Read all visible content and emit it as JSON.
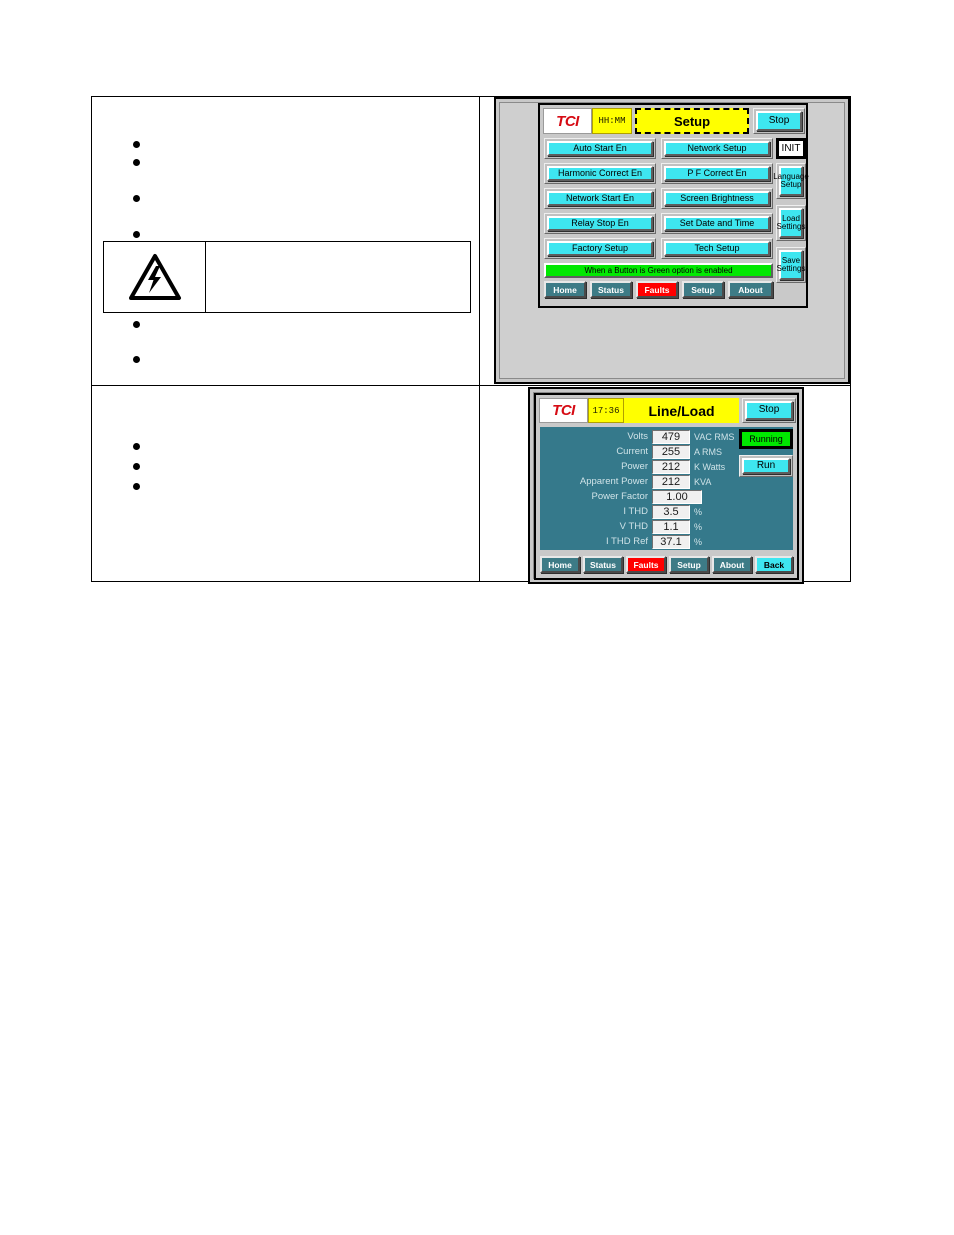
{
  "document": {
    "left_cells": {
      "top_bullets": 6,
      "bottom_bullets": 3
    },
    "warning_box": {
      "icon": "electrical-hazard-triangle-icon",
      "text": ""
    }
  },
  "setup_screen": {
    "logo": "TCI",
    "clock": "HH:MM",
    "title": "Setup",
    "stop_label": "Stop",
    "init_label": "INIT",
    "grid_buttons": [
      {
        "label": "Auto Start En"
      },
      {
        "label": "Network Setup"
      },
      {
        "label": "Harmonic Correct En"
      },
      {
        "label": "P F Correct En"
      },
      {
        "label": "Network Start En"
      },
      {
        "label": "Screen Brightness"
      },
      {
        "label": "Relay Stop En"
      },
      {
        "label": "Set Date and Time"
      },
      {
        "label": "Factory Setup"
      },
      {
        "label": "Tech Setup"
      }
    ],
    "side_buttons": [
      {
        "label": "Language Setup",
        "line1": "Language",
        "line2": "Setup"
      },
      {
        "label": "Load Settings",
        "line1": "Load",
        "line2": "Settings"
      },
      {
        "label": "Save Settings",
        "line1": "Save",
        "line2": "Settings"
      }
    ],
    "banner": "When a Button is Green option is enabled",
    "nav": [
      {
        "label": "Home",
        "style": "normal"
      },
      {
        "label": "Status",
        "style": "normal"
      },
      {
        "label": "Faults",
        "style": "faults"
      },
      {
        "label": "Setup",
        "style": "normal"
      },
      {
        "label": "About",
        "style": "normal"
      }
    ],
    "colors": {
      "button": "#3ee6f0",
      "title_bar": "#ffff00",
      "banner": "#00e800",
      "faults": "#ff0000",
      "nav": "#3d7b86",
      "logo": "#d60b14"
    }
  },
  "lineload_screen": {
    "logo": "TCI",
    "clock": "17:36",
    "title": "Line/Load",
    "stop_label": "Stop",
    "running_label": "Running",
    "run_label": "Run",
    "readings": [
      {
        "label": "Volts",
        "value": "479",
        "unit": "VAC RMS"
      },
      {
        "label": "Current",
        "value": "255",
        "unit": "A RMS"
      },
      {
        "label": "Power",
        "value": "212",
        "unit": "K Watts"
      },
      {
        "label": "Apparent Power",
        "value": "212",
        "unit": "KVA"
      },
      {
        "label": "Power Factor",
        "value": "1.00",
        "unit": ""
      },
      {
        "label": "I THD",
        "value": "3.5",
        "unit": "%"
      },
      {
        "label": "V THD",
        "value": "1.1",
        "unit": "%"
      },
      {
        "label": "I THD Ref",
        "value": "37.1",
        "unit": "%"
      }
    ],
    "nav": [
      {
        "label": "Home",
        "style": "normal"
      },
      {
        "label": "Status",
        "style": "normal"
      },
      {
        "label": "Faults",
        "style": "faults"
      },
      {
        "label": "Setup",
        "style": "normal"
      },
      {
        "label": "About",
        "style": "normal"
      },
      {
        "label": "Back",
        "style": "back"
      }
    ],
    "colors": {
      "body": "#35798b",
      "running": "#00e800",
      "title_bar": "#ffff00",
      "button": "#3ee6f0",
      "faults": "#ff0000"
    }
  }
}
